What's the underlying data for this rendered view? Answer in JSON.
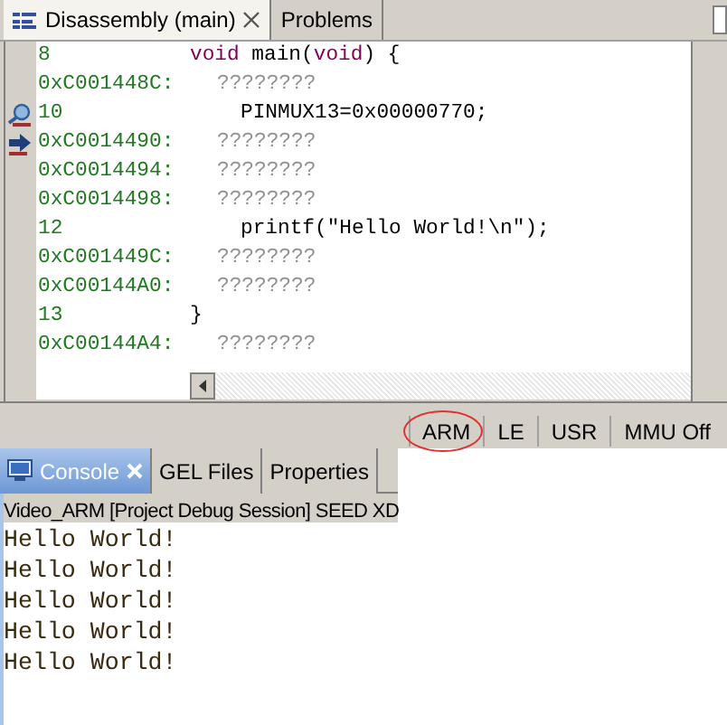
{
  "editor_tabs": [
    {
      "label": "Disassembly (main)",
      "selected": true,
      "closable": true
    },
    {
      "label": "Problems",
      "selected": false,
      "closable": false
    }
  ],
  "rows": [
    {
      "address": "8",
      "kind": "source",
      "indented": false,
      "breakpoint": false,
      "current": false,
      "code": [
        {
          "text": "void",
          "kind": "keyword"
        },
        {
          "text": " main(",
          "kind": "plain"
        },
        {
          "text": "void",
          "kind": "keyword"
        },
        {
          "text": ") {",
          "kind": "plain"
        }
      ]
    },
    {
      "address": "0xC001448C:",
      "kind": "asm",
      "breakpoint": false,
      "current": false,
      "code": [
        {
          "text": "????????",
          "kind": "plain"
        }
      ]
    },
    {
      "address": "10",
      "kind": "source",
      "indented": true,
      "breakpoint": true,
      "current": false,
      "code": [
        {
          "text": "PINMUX13=0x00000770;",
          "kind": "plain"
        }
      ]
    },
    {
      "address": "0xC0014490:",
      "kind": "asm",
      "breakpoint": false,
      "current": true,
      "code": [
        {
          "text": "????????",
          "kind": "plain"
        }
      ]
    },
    {
      "address": "0xC0014494:",
      "kind": "asm",
      "breakpoint": false,
      "current": false,
      "code": [
        {
          "text": "????????",
          "kind": "plain"
        }
      ]
    },
    {
      "address": "0xC0014498:",
      "kind": "asm",
      "breakpoint": false,
      "current": false,
      "code": [
        {
          "text": "????????",
          "kind": "plain"
        }
      ]
    },
    {
      "address": "12",
      "kind": "source",
      "indented": true,
      "breakpoint": false,
      "current": false,
      "code": [
        {
          "text": "printf(\"Hello World!\\n\");",
          "kind": "plain"
        }
      ]
    },
    {
      "address": "0xC001449C:",
      "kind": "asm",
      "breakpoint": false,
      "current": false,
      "code": [
        {
          "text": "????????",
          "kind": "plain"
        }
      ]
    },
    {
      "address": "0xC00144A0:",
      "kind": "asm",
      "breakpoint": false,
      "current": false,
      "code": [
        {
          "text": "????????",
          "kind": "plain"
        }
      ]
    },
    {
      "address": "13",
      "kind": "source",
      "indented": false,
      "breakpoint": false,
      "current": false,
      "code": [
        {
          "text": "}",
          "kind": "plain"
        }
      ]
    },
    {
      "address": "0xC00144A4:",
      "kind": "asm",
      "breakpoint": false,
      "current": false,
      "code": [
        {
          "text": "????????",
          "kind": "plain"
        }
      ]
    }
  ],
  "status_bar": [
    {
      "label": "ARM",
      "circled": true
    },
    {
      "label": "LE",
      "circled": false
    },
    {
      "label": "USR",
      "circled": false
    },
    {
      "label": "MMU Off",
      "circled": false
    }
  ],
  "console_tabs": [
    {
      "label": "Console",
      "selected": true,
      "closable": true
    },
    {
      "label": "GEL Files",
      "selected": false,
      "closable": false
    },
    {
      "label": "Properties",
      "selected": false,
      "closable": false
    }
  ],
  "console_header": "Video_ARM [Project Debug Session] SEED XD",
  "console_lines": [
    "Hello World!",
    "Hello World!",
    "Hello World!",
    "Hello World!",
    "Hello World!"
  ]
}
